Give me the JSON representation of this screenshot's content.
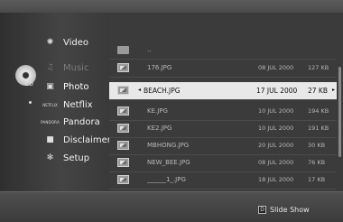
{
  "menu": {
    "disc_label": "CD",
    "items": [
      {
        "label": "Video",
        "icon": "video-reel-icon"
      },
      {
        "label": "Music",
        "icon": "music-icon"
      },
      {
        "label": "Photo",
        "icon": "photo-icon"
      },
      {
        "label": "Netflix",
        "icon": "netflix-logo",
        "logo_text": "NETFLIX"
      },
      {
        "label": "Pandora",
        "icon": "pandora-logo",
        "logo_text": "PANDORA"
      },
      {
        "label": "Disclaimer",
        "icon": "disclaimer-icon"
      },
      {
        "label": "Setup",
        "icon": "gear-icon"
      }
    ],
    "active": "Photo",
    "disabled": [
      "Music"
    ]
  },
  "file_list": {
    "parent_label": "..",
    "files": [
      {
        "name": "176.JPG",
        "date": "08 JUL 2000",
        "size": "127 KB"
      },
      {
        "name": "BEACH.JPG",
        "date": "17 JUL 2000",
        "size": "27 KB",
        "selected": true
      },
      {
        "name": "KE.JPG",
        "date": "10 JUL 2000",
        "size": "194 KB"
      },
      {
        "name": "KE2.JPG",
        "date": "10 JUL 2000",
        "size": "191 KB"
      },
      {
        "name": "MBHONG.JPG",
        "date": "20 JUL 2000",
        "size": "30 KB"
      },
      {
        "name": "NEW_BEE.JPG",
        "date": "08 JUL 2000",
        "size": "76 KB"
      },
      {
        "name": "______1_.JPG",
        "date": "18 JUL 2000",
        "size": "17 KB"
      }
    ],
    "sel_left_arrow": "◂",
    "sel_right_arrow": "▸"
  },
  "footer": {
    "key": "D",
    "label": "Slide Show"
  }
}
